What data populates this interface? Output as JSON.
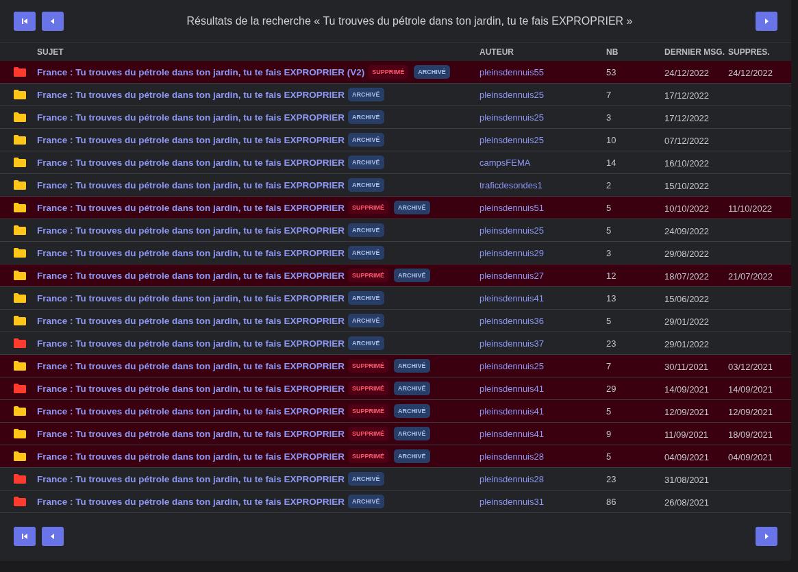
{
  "title": "Résultats de la recherche « Tu trouves du pétrole dans ton jardin, tu te fais EXPROPRIER »",
  "columns": [
    "SUJET",
    "AUTEUR",
    "NB",
    "DERNIER MSG.",
    "SUPPRES."
  ],
  "rows": [
    {
      "color": "#ff3b30",
      "deleted": true,
      "subject": "France : Tu trouves du pétrole dans ton jardin, tu te fais EXPROPRIER (V2)",
      "badges": [
        {
          "kind": "deleted",
          "label": "SUPPRIMÉ"
        },
        {
          "kind": "archived",
          "label": "ARCHIVÉ"
        }
      ],
      "author": "pleinsdennuis55",
      "count": "53",
      "last": "24/12/2022",
      "removed": "24/12/2022"
    },
    {
      "color": "#ffc61a",
      "deleted": false,
      "subject": "France : Tu trouves du pétrole dans ton jardin, tu te fais EXPROPRIER",
      "badges": [
        {
          "kind": "archived",
          "label": "ARCHIVÉ"
        }
      ],
      "author": "pleinsdennuis25",
      "count": "7",
      "last": "17/12/2022"
    },
    {
      "color": "#ffc61a",
      "deleted": false,
      "subject": "France : Tu trouves du pétrole dans ton jardin, tu te fais EXPROPRIER",
      "badges": [
        {
          "kind": "archived",
          "label": "ARCHIVÉ"
        }
      ],
      "author": "pleinsdennuis25",
      "count": "3",
      "last": "17/12/2022"
    },
    {
      "color": "#ffc61a",
      "deleted": false,
      "subject": "France : Tu trouves du pétrole dans ton jardin, tu te fais EXPROPRIER",
      "badges": [
        {
          "kind": "archived",
          "label": "ARCHIVÉ"
        }
      ],
      "author": "pleinsdennuis25",
      "count": "10",
      "last": "07/12/2022"
    },
    {
      "color": "#ffc61a",
      "deleted": false,
      "subject": "France : Tu trouves du pétrole dans ton jardin, tu te fais EXPROPRIER",
      "badges": [
        {
          "kind": "archived",
          "label": "ARCHIVÉ"
        }
      ],
      "author": "campsFEMA",
      "count": "14",
      "last": "16/10/2022"
    },
    {
      "color": "#ffc61a",
      "deleted": false,
      "subject": "France : Tu trouves du pétrole dans ton jardin, tu te fais EXPROPRIER",
      "badges": [
        {
          "kind": "archived",
          "label": "ARCHIVÉ"
        }
      ],
      "author": "traficdesondes1",
      "count": "2",
      "last": "15/10/2022"
    },
    {
      "color": "#ffc61a",
      "deleted": true,
      "subject": "France : Tu trouves du pétrole dans ton jardin, tu te fais EXPROPRIER",
      "badges": [
        {
          "kind": "deleted",
          "label": "SUPPRIMÉ"
        },
        {
          "kind": "archived",
          "label": "ARCHIVÉ"
        }
      ],
      "author": "pleinsdennuis51",
      "count": "5",
      "last": "10/10/2022",
      "removed": "11/10/2022"
    },
    {
      "color": "#ffc61a",
      "deleted": false,
      "subject": "France : Tu trouves du pétrole dans ton jardin, tu te fais EXPROPRIER",
      "badges": [
        {
          "kind": "archived",
          "label": "ARCHIVÉ"
        }
      ],
      "author": "pleinsdennuis25",
      "count": "5",
      "last": "24/09/2022"
    },
    {
      "color": "#ffc61a",
      "deleted": false,
      "subject": "France : Tu trouves du pétrole dans ton jardin, tu te fais EXPROPRIER",
      "badges": [
        {
          "kind": "archived",
          "label": "ARCHIVÉ"
        }
      ],
      "author": "pleinsdennuis29",
      "count": "3",
      "last": "29/08/2022"
    },
    {
      "color": "#ffc61a",
      "deleted": true,
      "subject": "France : Tu trouves du pétrole dans ton jardin, tu te fais EXPROPRIER",
      "badges": [
        {
          "kind": "deleted",
          "label": "SUPPRIMÉ"
        },
        {
          "kind": "archived",
          "label": "ARCHIVÉ"
        }
      ],
      "author": "pleinsdennuis27",
      "count": "12",
      "last": "18/07/2022",
      "removed": "21/07/2022"
    },
    {
      "color": "#ffc61a",
      "deleted": false,
      "subject": "France : Tu trouves du pétrole dans ton jardin, tu te fais EXPROPRIER",
      "badges": [
        {
          "kind": "archived",
          "label": "ARCHIVÉ"
        }
      ],
      "author": "pleinsdennuis41",
      "count": "13",
      "last": "15/06/2022"
    },
    {
      "color": "#ffc61a",
      "deleted": false,
      "subject": "France : Tu trouves du pétrole dans ton jardin, tu te fais EXPROPRIER",
      "badges": [
        {
          "kind": "archived",
          "label": "ARCHIVÉ"
        }
      ],
      "author": "pleinsdennuis36",
      "count": "5",
      "last": "29/01/2022"
    },
    {
      "color": "#ff3b30",
      "deleted": false,
      "subject": "France : Tu trouves du pétrole dans ton jardin, tu te fais EXPROPRIER",
      "badges": [
        {
          "kind": "archived",
          "label": "ARCHIVÉ"
        }
      ],
      "author": "pleinsdennuis37",
      "count": "23",
      "last": "29/01/2022"
    },
    {
      "color": "#ffc61a",
      "deleted": true,
      "subject": "France : Tu trouves du pétrole dans ton jardin, tu te fais EXPROPRIER",
      "badges": [
        {
          "kind": "deleted",
          "label": "SUPPRIMÉ"
        },
        {
          "kind": "archived",
          "label": "ARCHIVÉ"
        }
      ],
      "author": "pleinsdennuis25",
      "count": "7",
      "last": "30/11/2021",
      "removed": "03/12/2021"
    },
    {
      "color": "#ff3b30",
      "deleted": true,
      "subject": "France : Tu trouves du pétrole dans ton jardin, tu te fais EXPROPRIER",
      "badges": [
        {
          "kind": "deleted",
          "label": "SUPPRIMÉ"
        },
        {
          "kind": "archived",
          "label": "ARCHIVÉ"
        }
      ],
      "author": "pleinsdennuis41",
      "count": "29",
      "last": "14/09/2021",
      "removed": "14/09/2021"
    },
    {
      "color": "#ffc61a",
      "deleted": true,
      "subject": "France : Tu trouves du pétrole dans ton jardin, tu te fais EXPROPRIER",
      "badges": [
        {
          "kind": "deleted",
          "label": "SUPPRIMÉ"
        },
        {
          "kind": "archived",
          "label": "ARCHIVÉ"
        }
      ],
      "author": "pleinsdennuis41",
      "count": "5",
      "last": "12/09/2021",
      "removed": "12/09/2021"
    },
    {
      "color": "#ffc61a",
      "deleted": true,
      "subject": "France : Tu trouves du pétrole dans ton jardin, tu te fais EXPROPRIER",
      "badges": [
        {
          "kind": "deleted",
          "label": "SUPPRIMÉ"
        },
        {
          "kind": "archived",
          "label": "ARCHIVÉ"
        }
      ],
      "author": "pleinsdennuis41",
      "count": "9",
      "last": "11/09/2021",
      "removed": "18/09/2021"
    },
    {
      "color": "#ffc61a",
      "deleted": true,
      "subject": "France : Tu trouves du pétrole dans ton jardin, tu te fais EXPROPRIER",
      "badges": [
        {
          "kind": "deleted",
          "label": "SUPPRIMÉ"
        },
        {
          "kind": "archived",
          "label": "ARCHIVÉ"
        }
      ],
      "author": "pleinsdennuis28",
      "count": "5",
      "last": "04/09/2021",
      "removed": "04/09/2021"
    },
    {
      "color": "#ff3b30",
      "deleted": false,
      "subject": "France : Tu trouves du pétrole dans ton jardin, tu te fais EXPROPRIER",
      "badges": [
        {
          "kind": "archived",
          "label": "ARCHIVÉ"
        }
      ],
      "author": "pleinsdennuis28",
      "count": "23",
      "last": "31/08/2021"
    },
    {
      "color": "#ff3b30",
      "deleted": false,
      "subject": "France : Tu trouves du pétrole dans ton jardin, tu te fais EXPROPRIER",
      "badges": [
        {
          "kind": "archived",
          "label": "ARCHIVÉ"
        }
      ],
      "author": "pleinsdennuis31",
      "count": "86",
      "last": "26/08/2021"
    }
  ]
}
